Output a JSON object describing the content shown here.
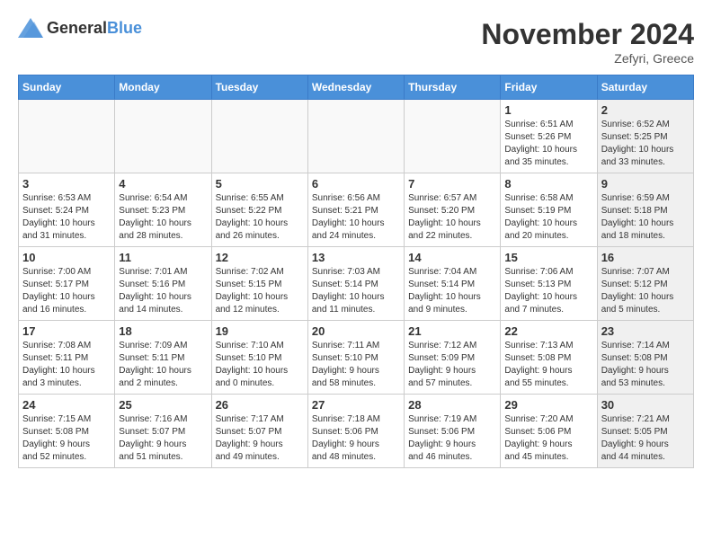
{
  "header": {
    "logo_general": "General",
    "logo_blue": "Blue",
    "month_title": "November 2024",
    "location": "Zefyri, Greece"
  },
  "weekdays": [
    "Sunday",
    "Monday",
    "Tuesday",
    "Wednesday",
    "Thursday",
    "Friday",
    "Saturday"
  ],
  "weeks": [
    [
      {
        "day": "",
        "info": "",
        "empty": true
      },
      {
        "day": "",
        "info": "",
        "empty": true
      },
      {
        "day": "",
        "info": "",
        "empty": true
      },
      {
        "day": "",
        "info": "",
        "empty": true
      },
      {
        "day": "",
        "info": "",
        "empty": true
      },
      {
        "day": "1",
        "info": "Sunrise: 6:51 AM\nSunset: 5:26 PM\nDaylight: 10 hours\nand 35 minutes.",
        "empty": false,
        "shaded": false
      },
      {
        "day": "2",
        "info": "Sunrise: 6:52 AM\nSunset: 5:25 PM\nDaylight: 10 hours\nand 33 minutes.",
        "empty": false,
        "shaded": true
      }
    ],
    [
      {
        "day": "3",
        "info": "Sunrise: 6:53 AM\nSunset: 5:24 PM\nDaylight: 10 hours\nand 31 minutes.",
        "empty": false,
        "shaded": false
      },
      {
        "day": "4",
        "info": "Sunrise: 6:54 AM\nSunset: 5:23 PM\nDaylight: 10 hours\nand 28 minutes.",
        "empty": false,
        "shaded": false
      },
      {
        "day": "5",
        "info": "Sunrise: 6:55 AM\nSunset: 5:22 PM\nDaylight: 10 hours\nand 26 minutes.",
        "empty": false,
        "shaded": false
      },
      {
        "day": "6",
        "info": "Sunrise: 6:56 AM\nSunset: 5:21 PM\nDaylight: 10 hours\nand 24 minutes.",
        "empty": false,
        "shaded": false
      },
      {
        "day": "7",
        "info": "Sunrise: 6:57 AM\nSunset: 5:20 PM\nDaylight: 10 hours\nand 22 minutes.",
        "empty": false,
        "shaded": false
      },
      {
        "day": "8",
        "info": "Sunrise: 6:58 AM\nSunset: 5:19 PM\nDaylight: 10 hours\nand 20 minutes.",
        "empty": false,
        "shaded": false
      },
      {
        "day": "9",
        "info": "Sunrise: 6:59 AM\nSunset: 5:18 PM\nDaylight: 10 hours\nand 18 minutes.",
        "empty": false,
        "shaded": true
      }
    ],
    [
      {
        "day": "10",
        "info": "Sunrise: 7:00 AM\nSunset: 5:17 PM\nDaylight: 10 hours\nand 16 minutes.",
        "empty": false,
        "shaded": false
      },
      {
        "day": "11",
        "info": "Sunrise: 7:01 AM\nSunset: 5:16 PM\nDaylight: 10 hours\nand 14 minutes.",
        "empty": false,
        "shaded": false
      },
      {
        "day": "12",
        "info": "Sunrise: 7:02 AM\nSunset: 5:15 PM\nDaylight: 10 hours\nand 12 minutes.",
        "empty": false,
        "shaded": false
      },
      {
        "day": "13",
        "info": "Sunrise: 7:03 AM\nSunset: 5:14 PM\nDaylight: 10 hours\nand 11 minutes.",
        "empty": false,
        "shaded": false
      },
      {
        "day": "14",
        "info": "Sunrise: 7:04 AM\nSunset: 5:14 PM\nDaylight: 10 hours\nand 9 minutes.",
        "empty": false,
        "shaded": false
      },
      {
        "day": "15",
        "info": "Sunrise: 7:06 AM\nSunset: 5:13 PM\nDaylight: 10 hours\nand 7 minutes.",
        "empty": false,
        "shaded": false
      },
      {
        "day": "16",
        "info": "Sunrise: 7:07 AM\nSunset: 5:12 PM\nDaylight: 10 hours\nand 5 minutes.",
        "empty": false,
        "shaded": true
      }
    ],
    [
      {
        "day": "17",
        "info": "Sunrise: 7:08 AM\nSunset: 5:11 PM\nDaylight: 10 hours\nand 3 minutes.",
        "empty": false,
        "shaded": false
      },
      {
        "day": "18",
        "info": "Sunrise: 7:09 AM\nSunset: 5:11 PM\nDaylight: 10 hours\nand 2 minutes.",
        "empty": false,
        "shaded": false
      },
      {
        "day": "19",
        "info": "Sunrise: 7:10 AM\nSunset: 5:10 PM\nDaylight: 10 hours\nand 0 minutes.",
        "empty": false,
        "shaded": false
      },
      {
        "day": "20",
        "info": "Sunrise: 7:11 AM\nSunset: 5:10 PM\nDaylight: 9 hours\nand 58 minutes.",
        "empty": false,
        "shaded": false
      },
      {
        "day": "21",
        "info": "Sunrise: 7:12 AM\nSunset: 5:09 PM\nDaylight: 9 hours\nand 57 minutes.",
        "empty": false,
        "shaded": false
      },
      {
        "day": "22",
        "info": "Sunrise: 7:13 AM\nSunset: 5:08 PM\nDaylight: 9 hours\nand 55 minutes.",
        "empty": false,
        "shaded": false
      },
      {
        "day": "23",
        "info": "Sunrise: 7:14 AM\nSunset: 5:08 PM\nDaylight: 9 hours\nand 53 minutes.",
        "empty": false,
        "shaded": true
      }
    ],
    [
      {
        "day": "24",
        "info": "Sunrise: 7:15 AM\nSunset: 5:08 PM\nDaylight: 9 hours\nand 52 minutes.",
        "empty": false,
        "shaded": false
      },
      {
        "day": "25",
        "info": "Sunrise: 7:16 AM\nSunset: 5:07 PM\nDaylight: 9 hours\nand 51 minutes.",
        "empty": false,
        "shaded": false
      },
      {
        "day": "26",
        "info": "Sunrise: 7:17 AM\nSunset: 5:07 PM\nDaylight: 9 hours\nand 49 minutes.",
        "empty": false,
        "shaded": false
      },
      {
        "day": "27",
        "info": "Sunrise: 7:18 AM\nSunset: 5:06 PM\nDaylight: 9 hours\nand 48 minutes.",
        "empty": false,
        "shaded": false
      },
      {
        "day": "28",
        "info": "Sunrise: 7:19 AM\nSunset: 5:06 PM\nDaylight: 9 hours\nand 46 minutes.",
        "empty": false,
        "shaded": false
      },
      {
        "day": "29",
        "info": "Sunrise: 7:20 AM\nSunset: 5:06 PM\nDaylight: 9 hours\nand 45 minutes.",
        "empty": false,
        "shaded": false
      },
      {
        "day": "30",
        "info": "Sunrise: 7:21 AM\nSunset: 5:05 PM\nDaylight: 9 hours\nand 44 minutes.",
        "empty": false,
        "shaded": true
      }
    ]
  ]
}
